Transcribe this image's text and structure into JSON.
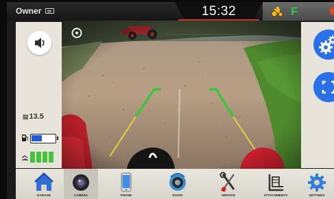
{
  "status_bar": {
    "profile_label": "Owner",
    "profile_icon": "id-card-icon",
    "time": "15:32",
    "machine_icon": "tractor-icon",
    "gear": "F",
    "alert_icon": "alert-dot-icon",
    "colors": {
      "accent_red": "#d4302a",
      "gear_green": "#26c94a",
      "alert": "#e9462a"
    }
  },
  "left_panel": {
    "volume_icon": "speaker-icon",
    "fuel_icon": "fuel-pump-icon",
    "def_icon": "def-fluid-icon",
    "hours_value": "13.5",
    "fuel_level": 0.45,
    "def_level_bars": 4,
    "colors": {
      "fuel_fill": "#1f5bd9",
      "def_fill": "#45c23a"
    }
  },
  "right_panel": {
    "settings_icon": "gears-icon",
    "fullscreen_icon": "fullscreen-icon",
    "colors": {
      "button": "#2a70e6"
    }
  },
  "nav": {
    "items": [
      {
        "label": "GARAGE",
        "icon": "garage-icon",
        "active": false
      },
      {
        "label": "CAMERA",
        "icon": "camera-icon",
        "active": true
      },
      {
        "label": "PHONE",
        "icon": "phone-icon",
        "active": false
      },
      {
        "label": "RADIO",
        "icon": "radio-icon",
        "active": false
      },
      {
        "label": "SERVICE",
        "icon": "wrench-screwdriver-icon",
        "active": false
      },
      {
        "label": "ATTACHMENTS",
        "icon": "attachment-icon",
        "active": false
      },
      {
        "label": "SETTINGS",
        "icon": "settings-gear-icon",
        "active": false
      }
    ]
  },
  "camera": {
    "guide_lines": "green-yellow parking guides"
  }
}
